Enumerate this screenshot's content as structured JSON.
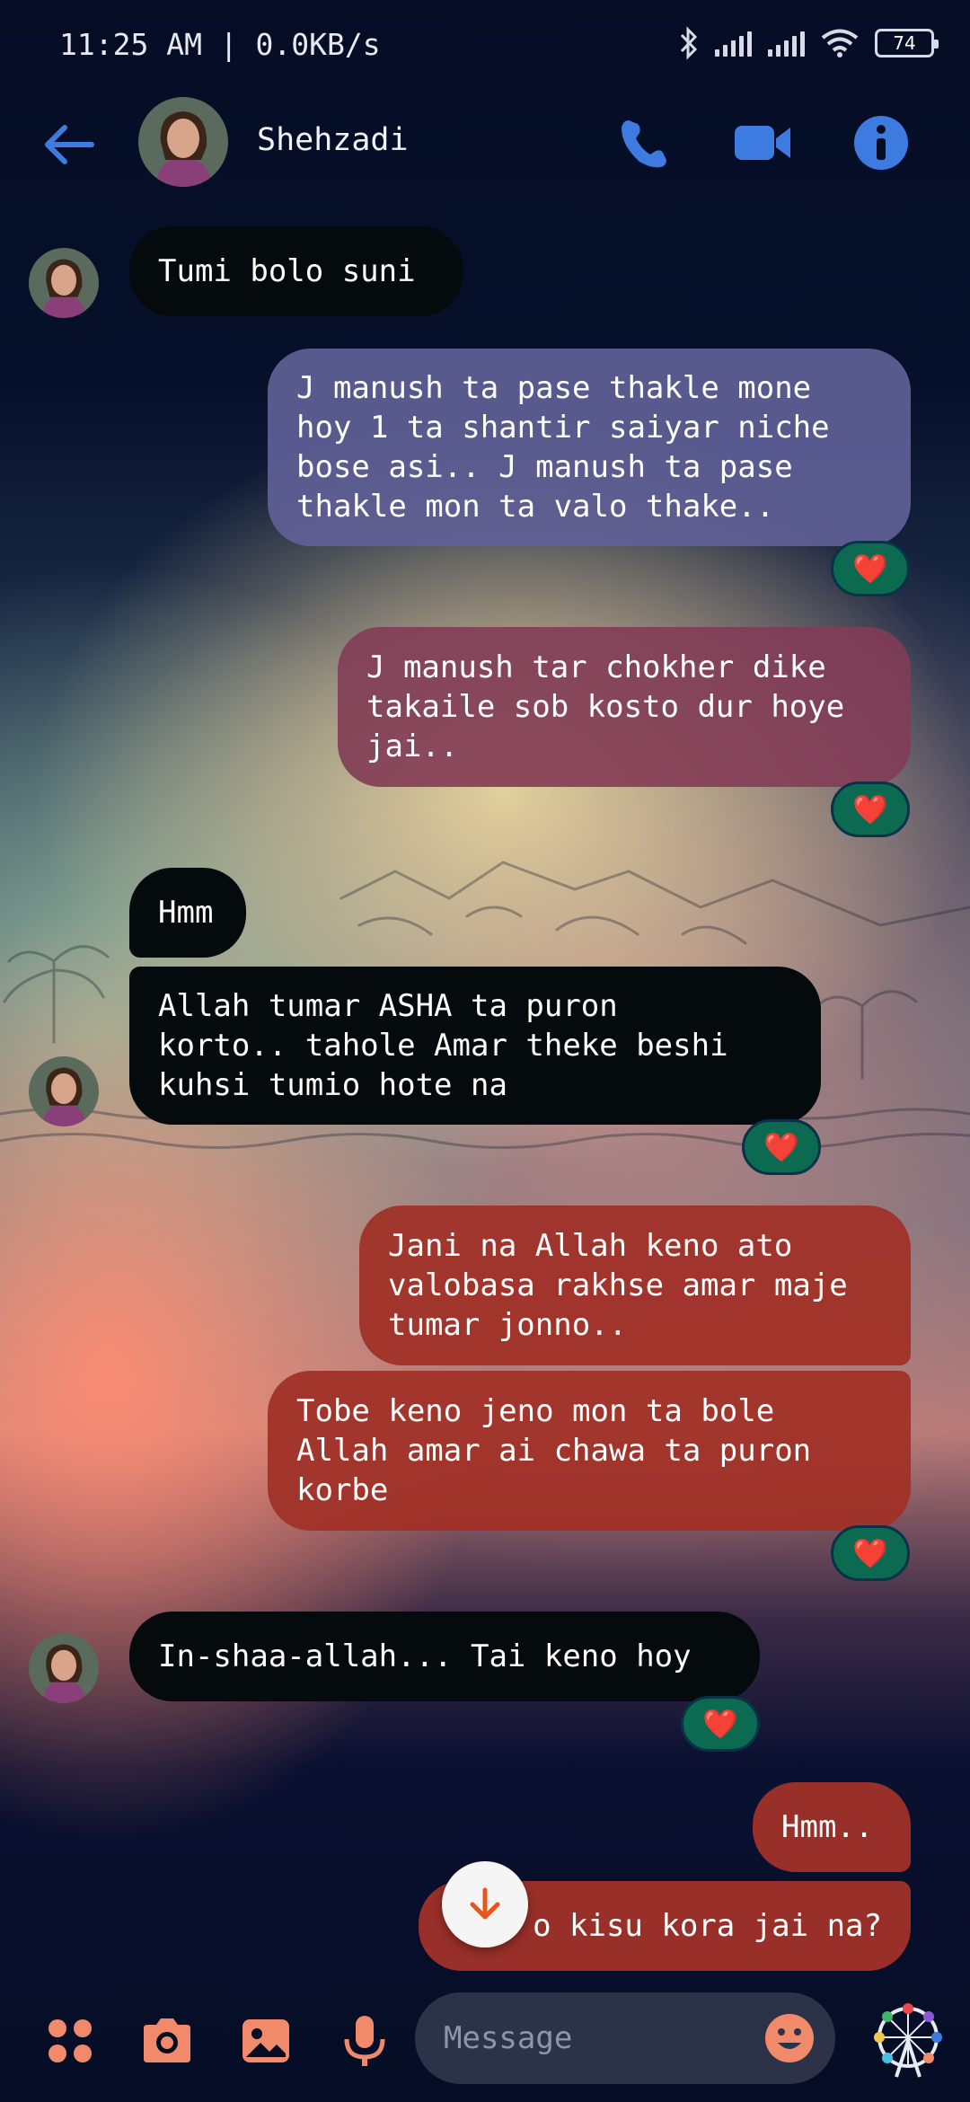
{
  "status_bar": {
    "time_speed": "11:25 AM | 0.0KB/s",
    "battery": "74"
  },
  "header": {
    "contact_name": "Shehzadi",
    "icons": [
      "back-arrow-icon",
      "phone-icon",
      "video-call-icon",
      "info-icon"
    ]
  },
  "messages": [
    {
      "dir": "received",
      "text": "Tumi bolo suni",
      "reaction": null
    },
    {
      "dir": "sent",
      "text": "J manush ta pase thakle mone\nhoy 1 ta shantir saiyar niche\nbose asi.. J manush ta pase\nthakle mon ta valo thake..",
      "reaction": "❤️"
    },
    {
      "dir": "sent",
      "text": "J manush tar chokher dike\ntakaile sob kosto dur hoye\njai..",
      "reaction": "❤️"
    },
    {
      "dir": "received",
      "text": "Hmm",
      "reaction": null
    },
    {
      "dir": "received",
      "text": "Allah tumar ASHA ta puron\nkorto.. tahole Amar theke beshi\nkuhsi tumio hote na",
      "reaction": "❤️"
    },
    {
      "dir": "sent",
      "text": "Jani na Allah keno ato\nvalobasa rakhse amar maje\ntumar jonno..",
      "reaction": null
    },
    {
      "dir": "sent",
      "text": "Tobe keno jeno mon ta bole\nAllah amar ai chawa ta puron\nkorbe",
      "reaction": "❤️"
    },
    {
      "dir": "received",
      "text": "In-shaa-allah... Tai keno hoy",
      "reaction": "❤️"
    },
    {
      "dir": "sent",
      "text": "Hmm..",
      "reaction": null
    },
    {
      "dir": "sent",
      "text": "o kisu kora jai na?",
      "reaction": null
    }
  ],
  "composer": {
    "placeholder": "Message",
    "icons": [
      "menu-dots-icon",
      "camera-icon",
      "gallery-icon",
      "microphone-icon",
      "emoji-icon",
      "sticker-icon"
    ]
  },
  "colors": {
    "accent_blue": "#3d7be0",
    "accent_orange": "#f08a6a",
    "reaction_bg": "#0b6a50"
  }
}
